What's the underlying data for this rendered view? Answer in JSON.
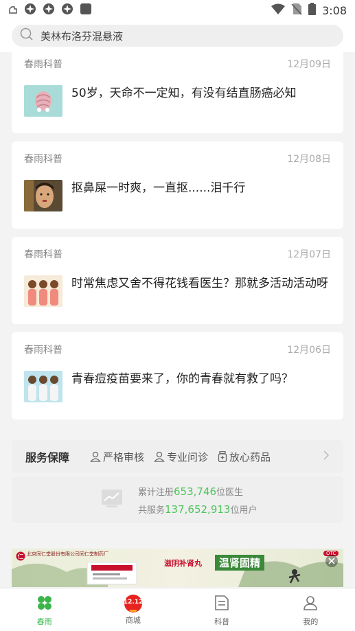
{
  "status_bar": {
    "time": "3:08"
  },
  "search": {
    "text": "美林布洛芬混悬液"
  },
  "feed": [
    {
      "source": "春雨科普",
      "date": "12月09日",
      "title": "50岁，天命不一定知，有没有结直肠癌必知"
    },
    {
      "source": "春雨科普",
      "date": "12月08日",
      "title": "抠鼻屎一时爽，一直抠......泪千行"
    },
    {
      "source": "春雨科普",
      "date": "12月07日",
      "title": "时常焦虑又舍不得花钱看医生？那就多活动活动呀"
    },
    {
      "source": "春雨科普",
      "date": "12月06日",
      "title": "青春痘疫苗要来了，你的青春就有救了吗？"
    }
  ],
  "service": {
    "title": "服务保障",
    "items": [
      "严格审核",
      "专业问诊",
      "放心药品"
    ]
  },
  "stats": {
    "line1_prefix": "累计注册",
    "doctors": "653,746",
    "line1_suffix": "位医生",
    "line2_prefix": "共服务",
    "users": "137,652,913",
    "line2_suffix": "位用户"
  },
  "banner": {
    "company": "北京同仁堂股份有限公司同仁堂制药厂",
    "product": "滋阴补肾丸",
    "slogan": "温肾固精",
    "badge": "OTC"
  },
  "tabs": [
    {
      "label": "春雨",
      "icon": "clover-icon",
      "active": true
    },
    {
      "label": "商城",
      "icon": "mall-1212-icon",
      "badge": "12.12"
    },
    {
      "label": "科普",
      "icon": "article-icon"
    },
    {
      "label": "我的",
      "icon": "profile-icon"
    }
  ],
  "colors": {
    "accent": "#3bb54a",
    "stats_number": "#4fc45a",
    "mall_badge": "#e8231f"
  }
}
